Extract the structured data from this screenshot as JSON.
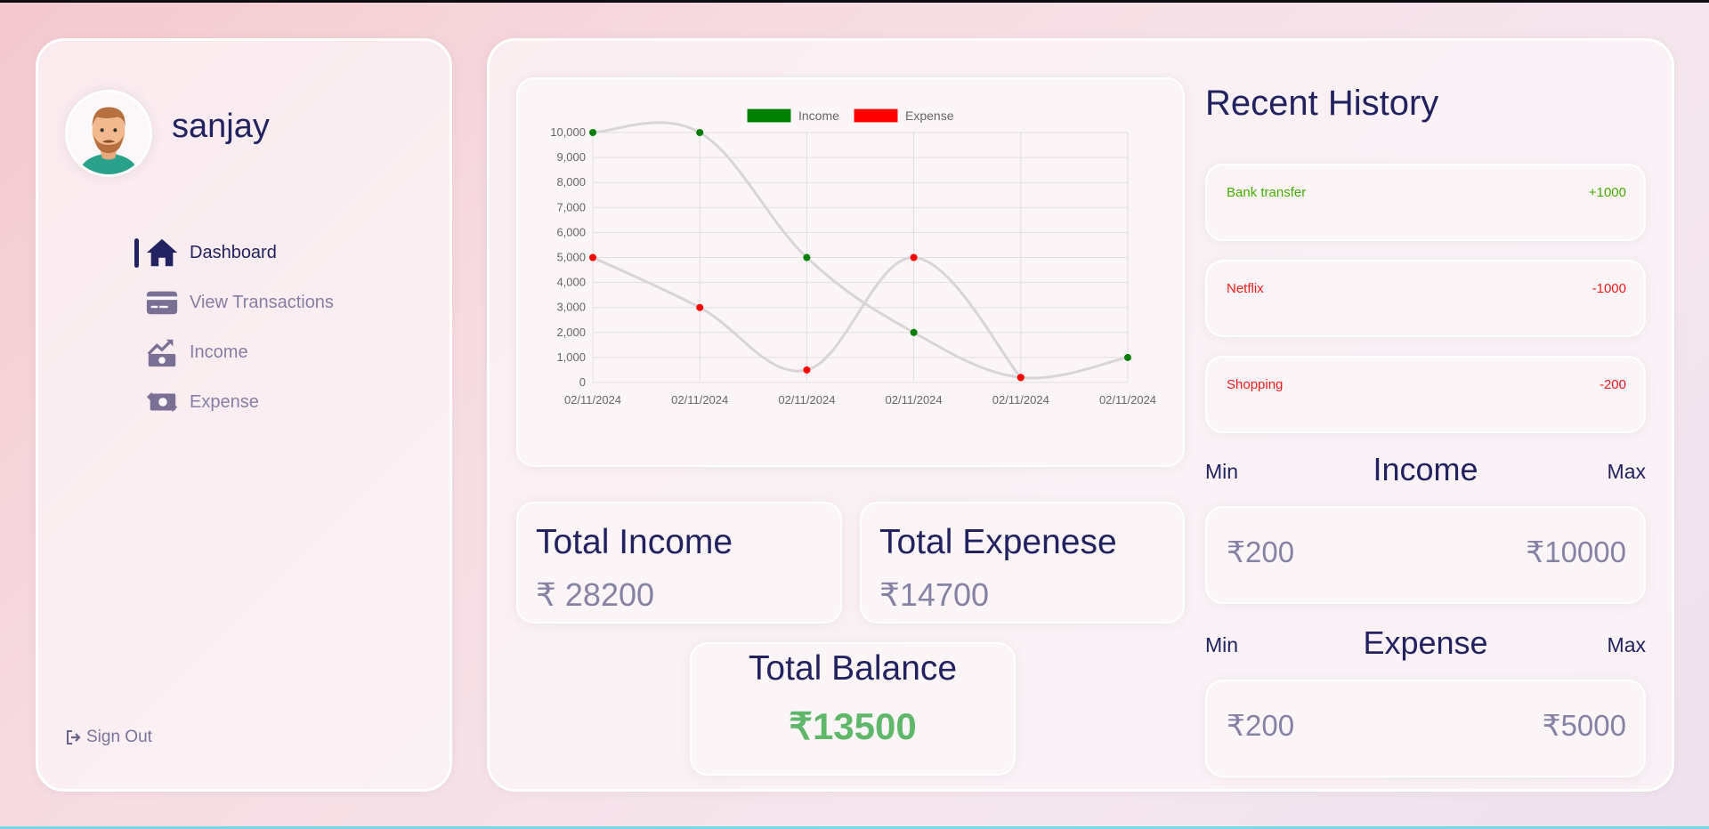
{
  "user": {
    "name": "sanjay"
  },
  "nav": {
    "items": [
      {
        "label": "Dashboard",
        "icon": "home-icon",
        "active": true
      },
      {
        "label": "View Transactions",
        "icon": "credit-card-icon",
        "active": false
      },
      {
        "label": "Income",
        "icon": "money-trend-icon",
        "active": false
      },
      {
        "label": "Expense",
        "icon": "money-exchange-icon",
        "active": false
      }
    ],
    "signout_label": "Sign Out"
  },
  "totals": {
    "income_title": "Total Income",
    "income_value": "₹ 28200",
    "expense_title": "Total Expenese",
    "expense_value": "₹14700",
    "balance_title": "Total Balance",
    "balance_value": "₹13500"
  },
  "history": {
    "title": "Recent History",
    "items": [
      {
        "label": "Bank transfer",
        "amount": "+1000",
        "type": "income"
      },
      {
        "label": "Netflix",
        "amount": "-1000",
        "type": "expense"
      },
      {
        "label": "Shopping",
        "amount": "-200",
        "type": "expense"
      }
    ]
  },
  "ranges": {
    "income": {
      "title": "Income",
      "min_label": "Min",
      "max_label": "Max",
      "min": "₹200",
      "max": "₹10000"
    },
    "expense": {
      "title": "Expense",
      "min_label": "Min",
      "max_label": "Max",
      "min": "₹200",
      "max": "₹5000"
    }
  },
  "colors": {
    "income": "#008000",
    "expense": "#ff0000",
    "primary": "#222260",
    "balance": "#5fb86a"
  },
  "chart_data": {
    "type": "line",
    "categories": [
      "02/11/2024",
      "02/11/2024",
      "02/11/2024",
      "02/11/2024",
      "02/11/2024",
      "02/11/2024"
    ],
    "series": [
      {
        "name": "Income",
        "values": [
          10000,
          10000,
          5000,
          2000,
          200,
          1000
        ],
        "color": "#008000"
      },
      {
        "name": "Expense",
        "values": [
          5000,
          3000,
          500,
          5000,
          200,
          null
        ],
        "color": "#ff0000"
      }
    ],
    "yticks": [
      "0",
      "1,000",
      "2,000",
      "3,000",
      "4,000",
      "5,000",
      "6,000",
      "7,000",
      "8,000",
      "9,000",
      "10,000"
    ],
    "ylim": [
      0,
      10000
    ],
    "grid": true,
    "legend": "top-center"
  }
}
